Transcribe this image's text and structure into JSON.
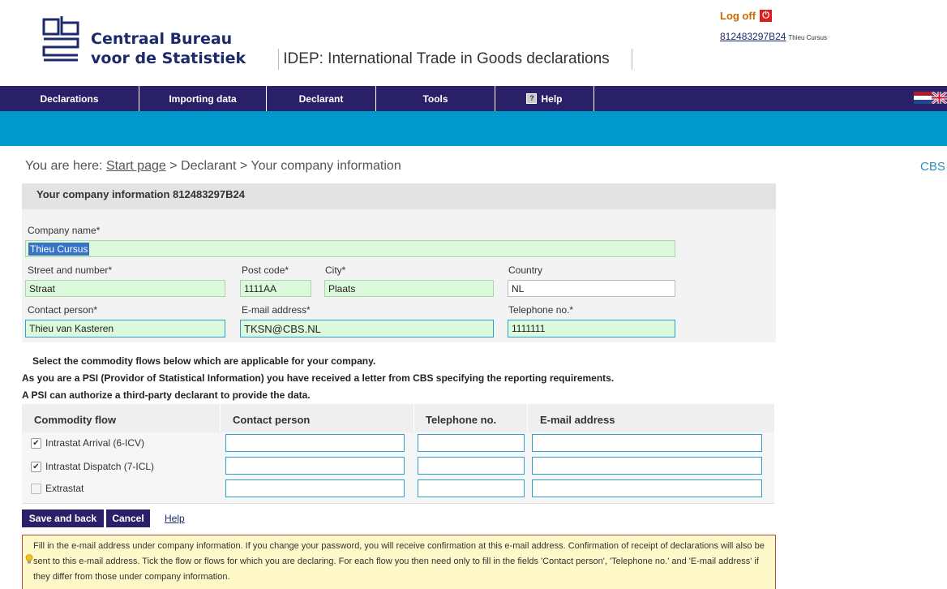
{
  "header": {
    "org_line1": "Centraal Bureau",
    "org_line2": "voor de Statistiek",
    "app_title": "IDEP: International Trade in Goods declarations",
    "logoff_label": "Log off",
    "logoff_icon": "power-icon",
    "user_id": "812483297B24",
    "user_name": "Thieu Cursus"
  },
  "nav": {
    "items": [
      "Declarations",
      "Importing data",
      "Declarant",
      "Tools",
      "Help"
    ],
    "language_flags": [
      "dutch-flag",
      "uk-flag"
    ],
    "colors": {
      "bar": "#2a2068",
      "subbar": "#0099cc"
    }
  },
  "breadcrumb": {
    "prefix": "You are here:",
    "start": "Start page",
    "rest": "> Declarant > Your company information",
    "cbs": "CBS"
  },
  "panel": {
    "title": "Your company information 812483297B24"
  },
  "form": {
    "company_name_label": "Company name*",
    "company_name": "Thieu Cursus",
    "street_label": "Street and number*",
    "street": "Straat",
    "postcode_label": "Post code*",
    "postcode": "1111AA",
    "city_label": "City*",
    "city": "Plaats",
    "country_label": "Country",
    "country": "NL",
    "contact_label": "Contact person*",
    "contact": "Thieu van Kasteren",
    "email_label": "E-mail address*",
    "email": "TKSN@CBS.NL",
    "phone_label": "Telephone no.*",
    "phone": "1111111"
  },
  "info": {
    "line1": "Select the commodity flows below which are applicable for your company.",
    "line2": "As you are a PSI (Providor of Statistical Information) you have received a letter from CBS specifying the reporting requirements.",
    "line3": "A PSI can authorize a third-party declarant to provide the data."
  },
  "flows": {
    "headers": [
      "Commodity flow",
      "Contact person",
      "Telephone no.",
      "E-mail address"
    ],
    "rows": [
      {
        "label": "Intrastat Arrival (6-ICV)",
        "checked": true
      },
      {
        "label": "Intrastat Dispatch (7-ICL)",
        "checked": true
      },
      {
        "label": "Extrastat",
        "checked": false
      }
    ]
  },
  "actions": {
    "save": "Save and back",
    "cancel": "Cancel",
    "help": "Help"
  },
  "note": {
    "icon": "lightbulb-icon",
    "text": "Fill in the e-mail address under company information. If you change your password, you will receive confirmation at this e-mail address. Confirmation of receipt of declarations will also be sent to this e-mail address. Tick the flow or flows for which you are declaring. For each flow you then need only to fill in the fields 'Contact person', 'Telephone no.' and 'E-mail address' if they differ from those under company information."
  }
}
